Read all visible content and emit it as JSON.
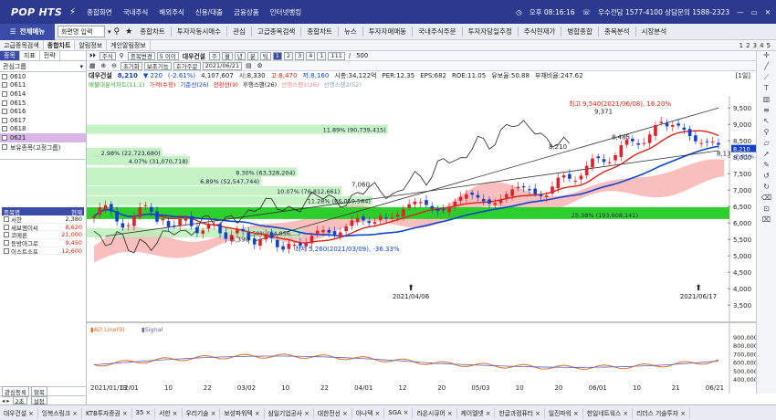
{
  "app": {
    "logo": "POP HTS",
    "menu": [
      "종합화면",
      "국내주식",
      "해외주식",
      "신용/대출",
      "금융상품",
      "인터넷뱅킹"
    ],
    "time": "오후 08:16:16",
    "contact": "우수전담 1577-4100 상담문의 1588-2323"
  },
  "menubar": {
    "main_label": "전체메뉴",
    "screen_input": "화면명 입력",
    "items": [
      "종합차트",
      "투자자동시매수",
      "관심",
      "고급종목검색",
      "종합차트",
      "뉴스",
      "투자자매매동",
      "국내주식주문",
      "투자자당일추정",
      "주식현재가",
      "병합종합",
      "종목분석",
      "시장분석"
    ]
  },
  "windows": {
    "left": [
      "고급종목검색",
      "종합차트",
      "알림정보",
      "계인알림정보"
    ],
    "right": [
      "1",
      "2",
      "3",
      "4",
      "5"
    ]
  },
  "left_panel": {
    "tabs": [
      "종목",
      "지표",
      "전략"
    ],
    "group": "관심그룹",
    "items": [
      "0610",
      "0611",
      "0614",
      "0615",
      "0616",
      "0617",
      "0618",
      "0621",
      "보유종목(고정그룹)"
    ],
    "selected_index": 7,
    "table_headers": [
      "종목명",
      "현재"
    ],
    "rows": [
      {
        "name": "서한",
        "price": "2,380"
      },
      {
        "name": "세보엠이씨",
        "price": "8,620"
      },
      {
        "name": "코메론",
        "price": "21,000"
      },
      {
        "name": "동방아그로",
        "price": "9,450"
      },
      {
        "name": "이스트소프",
        "price": "12,600"
      }
    ],
    "bottom_tabs": [
      "관심등록",
      "항목"
    ],
    "bottom_value": "2초",
    "bottom_btn": "설정"
  },
  "chart_toolbar": {
    "market": "주식",
    "code_label": "종목변경",
    "period": "5 이이",
    "name": "대우건설",
    "periods": [
      "주",
      "월",
      "년",
      "분",
      "틱"
    ],
    "nums": [
      "1",
      "2",
      "3",
      "4",
      "1"
    ],
    "count": "111",
    "total": "500",
    "controls": [
      "초기화",
      "보조기능",
      "호가주문"
    ],
    "date": "2021/06/21"
  },
  "info": {
    "name": "대우건설",
    "price": "8,210",
    "change": "▼ 220",
    "pct": "(-2.61%)",
    "volume": "4,107,607",
    "open": "시:8,330",
    "high": "고:8,470",
    "low": "저:8,160",
    "marketcap": "시총:34,122억",
    "per": "PER:12.35",
    "eps": "EPS:682",
    "roe": "ROE:11.05",
    "debt": "유보율:50.88",
    "debtratio": "부채비율:247.62",
    "unit": "[1일]"
  },
  "legend": [
    "매물대분석차트(11,1)",
    "가격(수정)",
    "기준선(26)",
    "전환선(9)",
    "후행스팬(26)",
    "선행스팬1(26)",
    "선행스팬2(52)"
  ],
  "chart_data": {
    "type": "candlestick",
    "y_ticks": [
      "9,500",
      "9,000",
      "8,500",
      "8,000",
      "7,500",
      "7,000",
      "6,500",
      "6,000",
      "5,500",
      "5,000",
      "4,500",
      "4,000",
      "3,500"
    ],
    "y_range": [
      3200,
      9700
    ],
    "x_ticks": [
      "2021/01/13",
      "02/01",
      "10",
      "22",
      "03/02",
      "10",
      "22",
      "04/01",
      "12",
      "20",
      "05/03",
      "10",
      "20",
      "06/01",
      "10",
      "21",
      "06/21"
    ],
    "volume_profile": [
      {
        "label": "11.89% (90,739,415)",
        "price": 8850,
        "pct": 11.89
      },
      {
        "label": "2.98% (22,723,680)",
        "price": 8150,
        "pct": 2.98
      },
      {
        "label": "4.07% (31,070,718)",
        "price": 7900,
        "pct": 4.07
      },
      {
        "label": "8.30% (63,328,204)",
        "price": 7550,
        "pct": 8.3
      },
      {
        "label": "6.89% (52,547,744)",
        "price": 7280,
        "pct": 6.89
      },
      {
        "label": "10.07% (76,812,661)",
        "price": 6980,
        "pct": 10.07
      },
      {
        "label": "11.28% (86,059,584)",
        "price": 6680,
        "pct": 11.28
      },
      {
        "label": "25.38% (193,608,141)",
        "price": 6300,
        "pct": 25.38
      },
      {
        "label": "8.50% (64,856,...)",
        "price": 5700,
        "pct": 8.5
      }
    ],
    "annotations": {
      "high": "최고 9,540(2021/06/08), 16.20%",
      "low": "최저 5,260(2021/03/09), -36.33%",
      "last": "8,13",
      "current": "8,210",
      "pct": "-2.61%",
      "mark1": "2021/04/06",
      "mark2": "2021/06/17",
      "p1": "9,371",
      "p2": "8,485",
      "p3": "8,210",
      "p4": "7,060",
      "p5": "5,390"
    },
    "lower_panel": {
      "legend": [
        "AD Line(9)",
        "Signal"
      ],
      "y_ticks": [
        "900,000",
        "800,000",
        "700,000",
        "600,000",
        "500,000",
        "400,000"
      ]
    }
  },
  "bottom_tabs": [
    "대우건설",
    "잉복스링크",
    "KTB투자증권",
    "35",
    "서한",
    "우리기술",
    "보성파워텍",
    "삼일기업공사",
    "대한전선",
    "아나텍",
    "SGA",
    "라온시큐어",
    "케이엘넷",
    "한글과컴퓨터",
    "일진파워",
    "한일네트웍스",
    "리더스 기술투자"
  ]
}
